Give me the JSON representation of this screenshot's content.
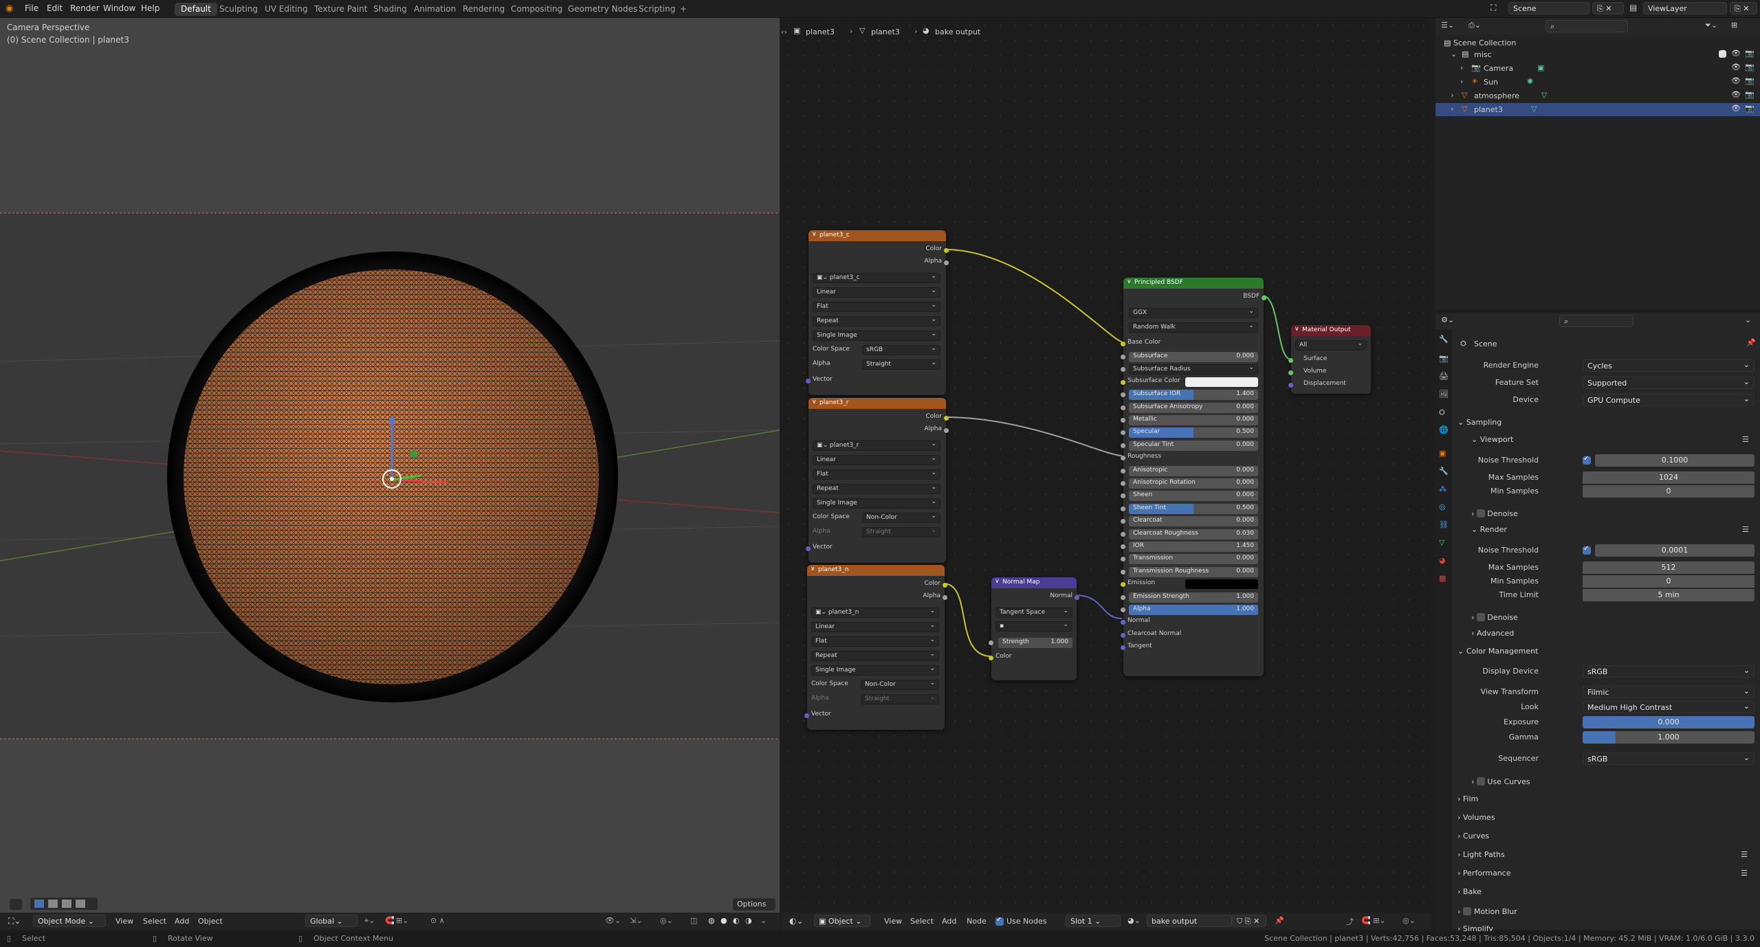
{
  "topbar": {
    "menus": [
      "File",
      "Edit",
      "Render",
      "Window",
      "Help"
    ],
    "workspaces": [
      "Default",
      "Sculpting",
      "UV Editing",
      "Texture Paint",
      "Shading",
      "Animation",
      "Rendering",
      "Compositing",
      "Geometry Nodes",
      "Scripting"
    ],
    "add_tab": "+",
    "scene": "Scene",
    "view_layer": "ViewLayer"
  },
  "viewport": {
    "title": "Camera Perspective",
    "subtitle": "(0) Scene Collection | planet3",
    "options": "Options",
    "mode": "Object Mode",
    "menus": [
      "View",
      "Select",
      "Add",
      "Object"
    ],
    "transform": "Global"
  },
  "node_editor": {
    "breadcrumb": [
      "planet3",
      "planet3",
      "bake output"
    ],
    "object": "Object",
    "menus": [
      "View",
      "Select",
      "Add",
      "Node"
    ],
    "use_nodes": "Use Nodes",
    "slot": "Slot 1",
    "material": "bake output",
    "nodes": {
      "tex_c": {
        "title": "planet3_c",
        "image": "planet3_c",
        "interp": "Linear",
        "proj": "Flat",
        "ext": "Repeat",
        "source": "Single Image",
        "cs_label": "Color Space",
        "cs": "sRGB",
        "alpha_label": "Alpha",
        "alpha": "Straight",
        "out_color": "Color",
        "out_alpha": "Alpha",
        "in_vector": "Vector"
      },
      "tex_r": {
        "title": "planet3_r",
        "image": "planet3_r",
        "interp": "Linear",
        "proj": "Flat",
        "ext": "Repeat",
        "source": "Single Image",
        "cs_label": "Color Space",
        "cs": "Non-Color",
        "alpha_label": "Alpha",
        "alpha": "Straight",
        "out_color": "Color",
        "out_alpha": "Alpha",
        "in_vector": "Vector"
      },
      "tex_n": {
        "title": "planet3_n",
        "image": "planet3_n",
        "interp": "Linear",
        "proj": "Flat",
        "ext": "Repeat",
        "source": "Single Image",
        "cs_label": "Color Space",
        "cs": "Non-Color",
        "alpha_label": "Alpha",
        "alpha": "Straight",
        "out_color": "Color",
        "out_alpha": "Alpha",
        "in_vector": "Vector"
      },
      "normal_map": {
        "title": "Normal Map",
        "out": "Normal",
        "space": "Tangent Space",
        "uv": "",
        "strength_label": "Strength",
        "strength": "1.000",
        "in_color": "Color"
      },
      "bsdf": {
        "title": "Principled BSDF",
        "out": "BSDF",
        "dist": "GGX",
        "sss": "Random Walk",
        "base_color": "Base Color",
        "rows": [
          {
            "label": "Subsurface",
            "value": "0.000",
            "fill": 0
          },
          {
            "label": "Subsurface Radius",
            "value": "",
            "select": true
          },
          {
            "label": "Subsurface Color",
            "value": "",
            "color": true
          },
          {
            "label": "Subsurface IOR",
            "value": "1.400",
            "fill": 0.5
          },
          {
            "label": "Subsurface Anisotropy",
            "value": "0.000",
            "fill": 0
          },
          {
            "label": "Metallic",
            "value": "0.000",
            "fill": 0
          },
          {
            "label": "Specular",
            "value": "0.500",
            "fill": 0.5
          },
          {
            "label": "Specular Tint",
            "value": "0.000",
            "fill": 0
          },
          {
            "label": "Roughness",
            "value": "",
            "socket_only": true
          },
          {
            "label": "Anisotropic",
            "value": "0.000",
            "fill": 0
          },
          {
            "label": "Anisotropic Rotation",
            "value": "0.000",
            "fill": 0
          },
          {
            "label": "Sheen",
            "value": "0.000",
            "fill": 0
          },
          {
            "label": "Sheen Tint",
            "value": "0.500",
            "fill": 0.5
          },
          {
            "label": "Clearcoat",
            "value": "0.000",
            "fill": 0
          },
          {
            "label": "Clearcoat Roughness",
            "value": "0.030",
            "fill": 0
          },
          {
            "label": "IOR",
            "value": "1.450",
            "fill": 0
          },
          {
            "label": "Transmission",
            "value": "0.000",
            "fill": 0
          },
          {
            "label": "Transmission Roughness",
            "value": "0.000",
            "fill": 0
          },
          {
            "label": "Emission",
            "value": "",
            "black": true
          },
          {
            "label": "Emission Strength",
            "value": "1.000",
            "fill": 0
          },
          {
            "label": "Alpha",
            "value": "1.000",
            "fill": 1
          },
          {
            "label": "Normal",
            "value": "",
            "socket_only": true
          },
          {
            "label": "Clearcoat Normal",
            "value": "",
            "socket_only": true
          },
          {
            "label": "Tangent",
            "value": "",
            "socket_only": true
          }
        ]
      },
      "output": {
        "title": "Material Output",
        "target": "All",
        "in_surface": "Surface",
        "in_volume": "Volume",
        "in_disp": "Displacement"
      }
    }
  },
  "outliner": {
    "root": "Scene Collection",
    "items": [
      {
        "label": "misc",
        "indent": 1,
        "selected": false
      },
      {
        "label": "Camera",
        "indent": 2,
        "selected": false
      },
      {
        "label": "Sun",
        "indent": 2,
        "selected": false
      },
      {
        "label": "atmosphere",
        "indent": 1,
        "selected": false
      },
      {
        "label": "planet3",
        "indent": 1,
        "selected": true
      }
    ]
  },
  "properties": {
    "context": "Scene",
    "render_engine_label": "Render Engine",
    "render_engine": "Cycles",
    "feature_set_label": "Feature Set",
    "feature_set": "Supported",
    "device_label": "Device",
    "device": "GPU Compute",
    "sampling": "Sampling",
    "viewport": "Viewport",
    "vp_noise_label": "Noise Threshold",
    "vp_noise": "0.1000",
    "vp_max_label": "Max Samples",
    "vp_max": "1024",
    "vp_min_label": "Min Samples",
    "vp_min": "0",
    "denoise": "Denoise",
    "render": "Render",
    "r_noise_label": "Noise Threshold",
    "r_noise": "0.0001",
    "r_max_label": "Max Samples",
    "r_max": "512",
    "r_min_label": "Min Samples",
    "r_min": "0",
    "r_time_label": "Time Limit",
    "r_time": "5 min",
    "denoise2": "Denoise",
    "advanced": "Advanced",
    "color_mgmt": "Color Management",
    "display_device_label": "Display Device",
    "display_device": "sRGB",
    "view_transform_label": "View Transform",
    "view_transform": "Filmic",
    "look_label": "Look",
    "look": "Medium High Contrast",
    "exposure_label": "Exposure",
    "exposure": "0.000",
    "gamma_label": "Gamma",
    "gamma": "1.000",
    "sequencer_label": "Sequencer",
    "sequencer": "sRGB",
    "use_curves": "Use Curves",
    "panels": [
      "Film",
      "Volumes",
      "Curves",
      "Light Paths",
      "Performance",
      "Bake",
      "Motion Blur",
      "Simplify"
    ]
  },
  "statusbar": {
    "select": "Select",
    "rotate": "Rotate View",
    "context_menu": "Object Context Menu",
    "stats": "Scene Collection | planet3 | Verts:42,756 | Faces:53,248 | Tris:85,504 | Objects:1/4 | Memory: 45.2 MiB | VRAM: 1.0/6.0 GiB | 3.3.0"
  },
  "colors": {
    "accent": "#4772b3",
    "image_node_header": "#a2551f",
    "bsdf_header": "#2a7a2a",
    "output_header": "#6b1f2a",
    "normalmap_header": "#4b3c96",
    "planet": "#d9844e",
    "link_yellow": "#c7c729",
    "link_grey": "#a1a1a1",
    "link_purple": "#6363c7",
    "link_green": "#63c763"
  }
}
